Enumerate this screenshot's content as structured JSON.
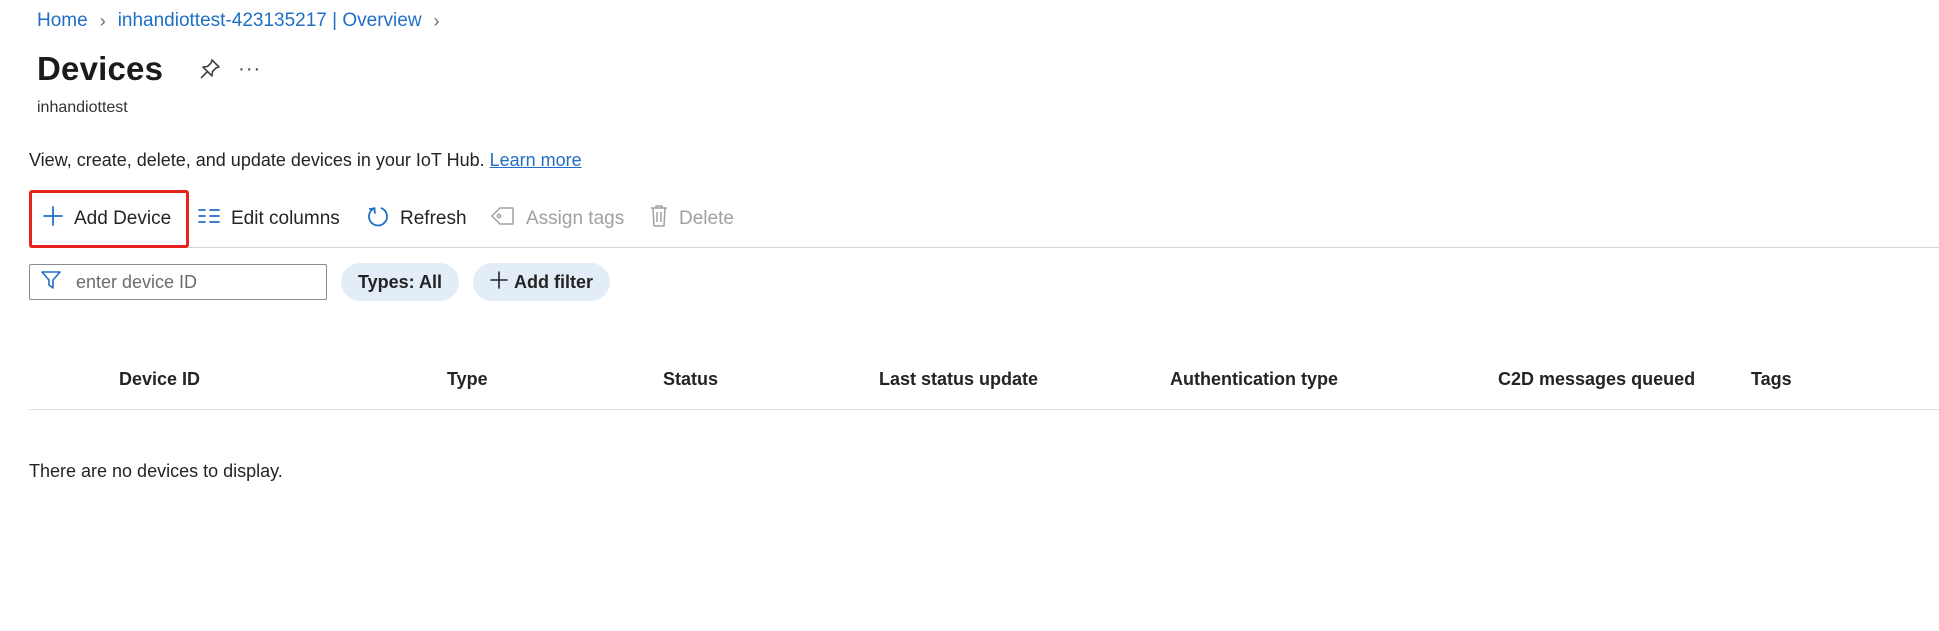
{
  "breadcrumb": {
    "items": [
      "Home",
      "inhandiottest-423135217 | Overview"
    ]
  },
  "header": {
    "title": "Devices",
    "subtitle": "inhandiottest",
    "more_label": "···"
  },
  "description": {
    "text": "View, create, delete, and update devices in your IoT Hub. ",
    "link": "Learn more"
  },
  "toolbar": {
    "add_device": "Add Device",
    "edit_columns": "Edit columns",
    "refresh": "Refresh",
    "assign_tags": "Assign tags",
    "delete": "Delete"
  },
  "filters": {
    "search_placeholder": "enter device ID",
    "types_pill": "Types: All",
    "add_filter": "Add filter"
  },
  "table": {
    "columns": [
      "Device ID",
      "Type",
      "Status",
      "Last status update",
      "Authentication type",
      "C2D messages queued",
      "Tags"
    ],
    "empty_message": "There are no devices to display."
  },
  "colors": {
    "link": "#1f6fc5",
    "highlight_border": "#e8231e",
    "pill_bg": "#e3edf8",
    "disabled": "#a0a0a0"
  }
}
